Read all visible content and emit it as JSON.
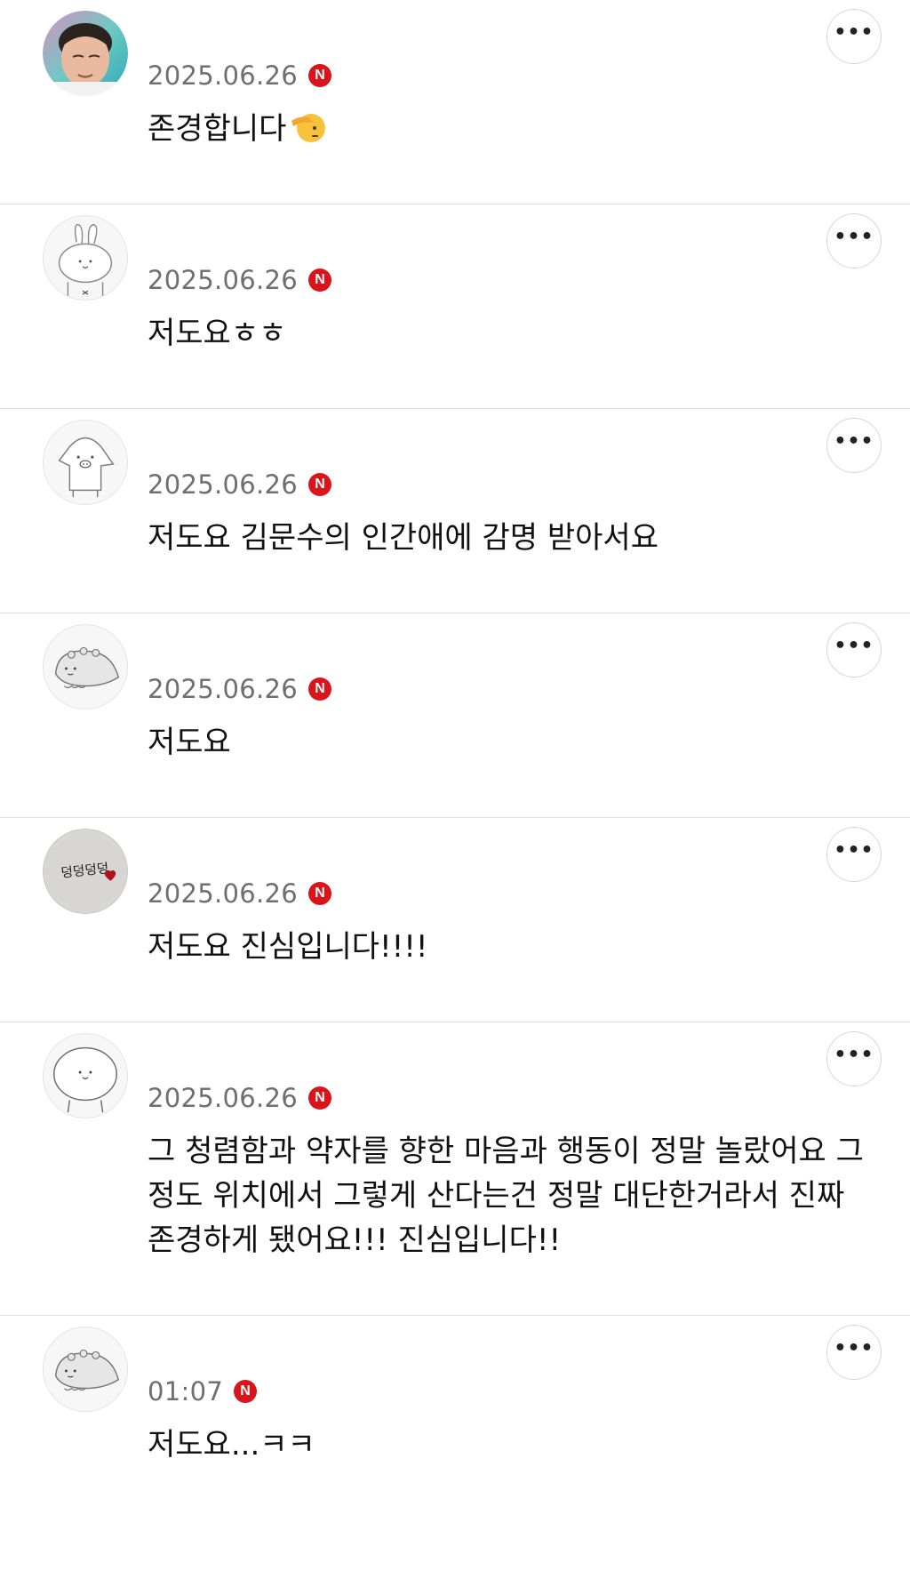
{
  "comments": [
    {
      "date": "2025.06.26",
      "badge": "N",
      "text": "존경합니다",
      "avatar_icon": "person-photo-avatar",
      "has_emoji": true,
      "emoji_icon": "saluting-face-emoji"
    },
    {
      "date": "2025.06.26",
      "badge": "N",
      "text": "저도요ㅎㅎ",
      "avatar_icon": "rabbit-avatar"
    },
    {
      "date": "2025.06.26",
      "badge": "N",
      "text": "저도요 김문수의 인간애에 감명 받아서요",
      "avatar_icon": "pig-character-avatar"
    },
    {
      "date": "2025.06.26",
      "badge": "N",
      "text": "저도요",
      "avatar_icon": "hedgehog-avatar"
    },
    {
      "date": "2025.06.26",
      "badge": "N",
      "text": "저도요 진심입니다!!!!",
      "avatar_icon": "handwriting-heart-avatar",
      "avatar_text": "덩덩덩덩"
    },
    {
      "date": "2025.06.26",
      "badge": "N",
      "text": "그 청렴함과 약자를 향한 마음과 행동이 정말 놀랐어요 그 정도 위치에서 그렇게 산다는건 정말 대단한거라서 진짜 존경하게 됐어요!!! 진심입니다!!",
      "avatar_icon": "round-blob-avatar"
    },
    {
      "date": "01:07",
      "badge": "N",
      "text": "저도요...ㅋㅋ",
      "avatar_icon": "hedgehog-avatar"
    }
  ],
  "more_button": {
    "label": "•••"
  },
  "colors": {
    "badge": "#d9141b",
    "date": "#6f6f6f",
    "text": "#111111",
    "divider": "#dedede"
  }
}
